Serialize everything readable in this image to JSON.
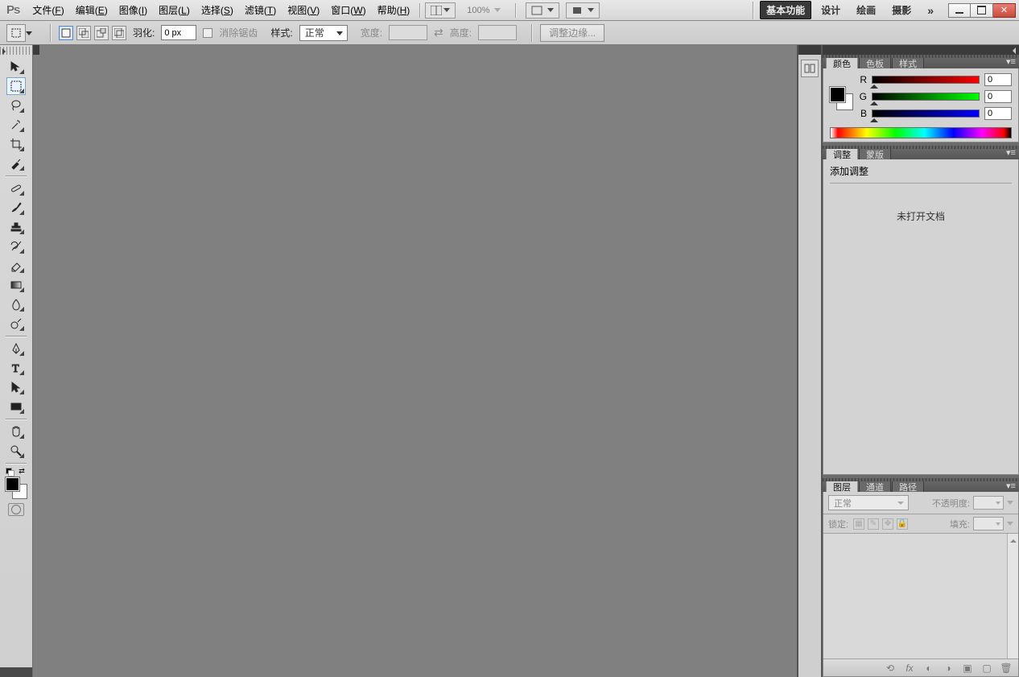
{
  "menubar": {
    "items": [
      {
        "label": "文件",
        "accel": "F"
      },
      {
        "label": "编辑",
        "accel": "E"
      },
      {
        "label": "图像",
        "accel": "I"
      },
      {
        "label": "图层",
        "accel": "L"
      },
      {
        "label": "选择",
        "accel": "S"
      },
      {
        "label": "滤镜",
        "accel": "T"
      },
      {
        "label": "视图",
        "accel": "V"
      },
      {
        "label": "窗口",
        "accel": "W"
      },
      {
        "label": "帮助",
        "accel": "H"
      }
    ],
    "zoom_label": "100%",
    "workspaces": [
      {
        "label": "基本功能",
        "active": true
      },
      {
        "label": "设计",
        "active": false
      },
      {
        "label": "绘画",
        "active": false
      },
      {
        "label": "摄影",
        "active": false
      }
    ]
  },
  "options": {
    "feather_label": "羽化:",
    "feather_value": "0 px",
    "antialias_label": "消除锯齿",
    "style_label": "样式:",
    "style_value": "正常",
    "width_label": "宽度:",
    "height_label": "高度:",
    "refine_edge_label": "调整边缘..."
  },
  "panels": {
    "color": {
      "tabs": [
        "颜色",
        "色板",
        "样式"
      ],
      "rgb": {
        "r_label": "R",
        "g_label": "G",
        "b_label": "B",
        "r": "0",
        "g": "0",
        "b": "0"
      }
    },
    "adjustments": {
      "tabs": [
        "调整",
        "蒙版"
      ],
      "title": "添加调整",
      "empty_msg": "未打开文档"
    },
    "layers": {
      "tabs": [
        "图层",
        "通道",
        "路径"
      ],
      "blend_mode": "正常",
      "opacity_label": "不透明度:",
      "lock_label": "锁定:",
      "fill_label": "填充:"
    }
  }
}
